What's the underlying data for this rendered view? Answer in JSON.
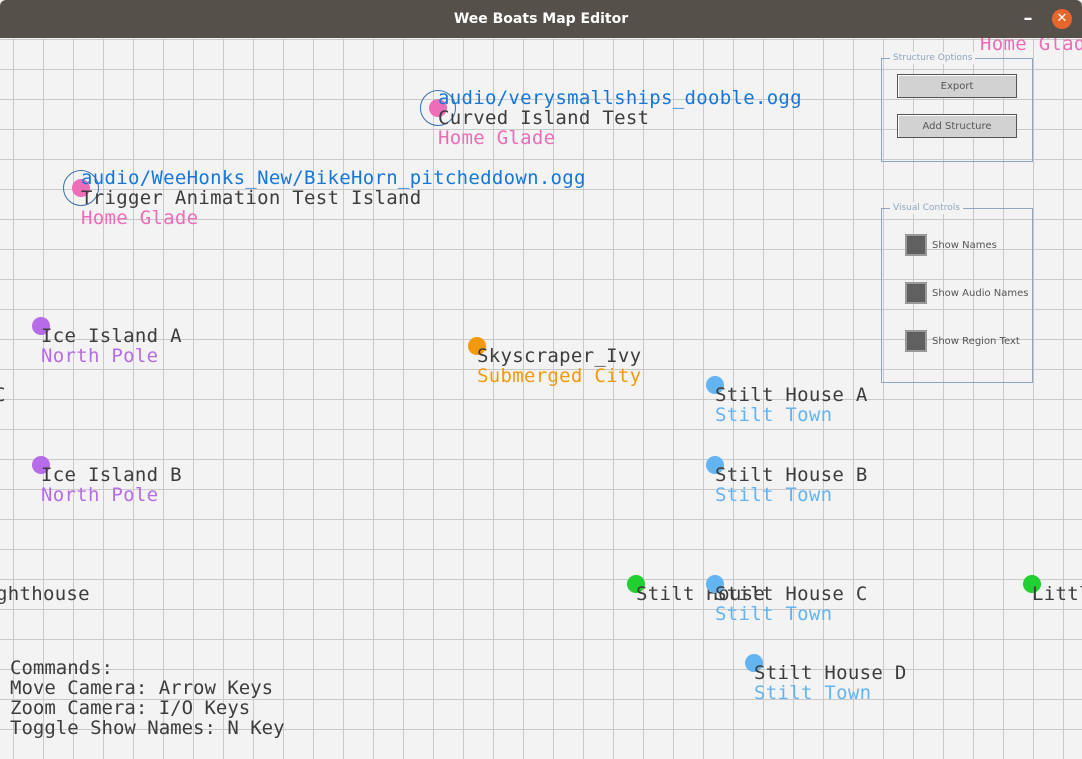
{
  "window": {
    "title": "Wee Boats Map Editor",
    "minimize_glyph": "–",
    "close_glyph": "✕",
    "close_color": "#e8662c"
  },
  "structures": [
    {
      "color": "#ee6cb8",
      "audio": "audio/verysmallships_dooble.ogg",
      "name": "Curved Island Test",
      "region": "Home Glade"
    },
    {
      "color": "#ee6cb8",
      "audio": "audio/WeeHonks_New/BikeHorn_pitcheddown.ogg",
      "name": "Trigger Animation Test Island",
      "region": "Home Glade"
    },
    {
      "color": "#b66ce8",
      "name": "Ice Island A",
      "region": "North Pole"
    },
    {
      "color": "#f29a0b",
      "name": "Skyscraper_Ivy",
      "region": "Submerged City"
    },
    {
      "color": "#64b4f2",
      "name": "Stilt House A",
      "region": "Stilt Town"
    },
    {
      "color": "#b66ce8",
      "name": "Ice Island B",
      "region": "North Pole"
    },
    {
      "color": "#64b4f2",
      "name": "Stilt House B",
      "region": "Stilt Town"
    },
    {
      "color": "#20d030",
      "name": "Stilt House"
    },
    {
      "color": "#64b4f2",
      "name": "Stilt House C",
      "region": "Stilt Town"
    },
    {
      "color": "#64b4f2",
      "name": "Stilt House D",
      "region": "Stilt Town"
    },
    {
      "color": "#20d030",
      "name": "Little"
    },
    {
      "name": "ghthouse"
    },
    {
      "name": "C"
    },
    {
      "region": "Home Glad"
    }
  ],
  "commands": {
    "heading": "Commands:",
    "lines": [
      "Move Camera: Arrow Keys",
      "Zoom Camera: I/O Keys",
      "Toggle Show Names: N Key"
    ]
  },
  "structure_options": {
    "title": "Structure Options",
    "export_label": "Export",
    "add_label": "Add Structure"
  },
  "visual_controls": {
    "title": "Visual Controls",
    "show_names": "Show Names",
    "show_audio_names": "Show Audio Names",
    "show_region_text": "Show Region Text"
  }
}
